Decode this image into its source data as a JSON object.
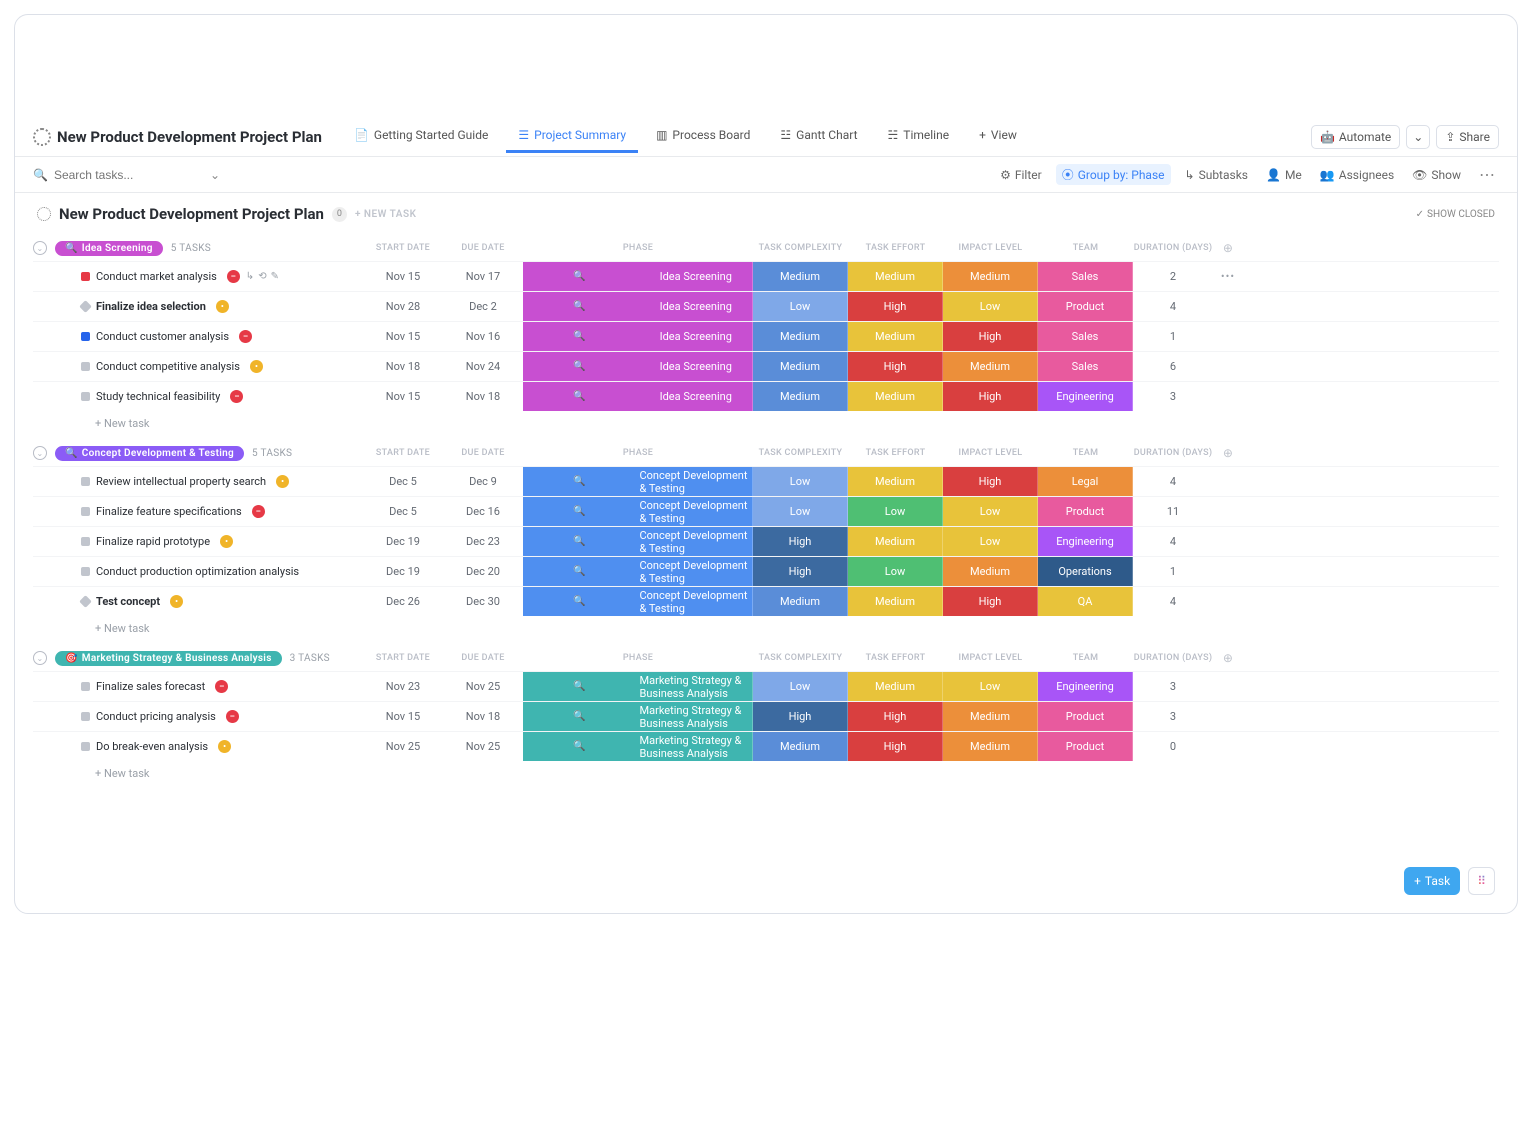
{
  "header": {
    "title": "New Product Development Project Plan",
    "tabs": [
      {
        "label": "Getting Started Guide"
      },
      {
        "label": "Project Summary",
        "active": true
      },
      {
        "label": "Process Board"
      },
      {
        "label": "Gantt Chart"
      },
      {
        "label": "Timeline"
      }
    ],
    "add_view": "View",
    "automate": "Automate",
    "share": "Share"
  },
  "toolbar": {
    "search_placeholder": "Search tasks...",
    "filter": "Filter",
    "group_by": "Group by: Phase",
    "subtasks": "Subtasks",
    "me": "Me",
    "assignees": "Assignees",
    "show": "Show"
  },
  "list": {
    "name": "New Product Development Project Plan",
    "count": "0",
    "new_task": "+ NEW TASK",
    "show_closed": "SHOW CLOSED"
  },
  "columns": [
    "",
    "START DATE",
    "DUE DATE",
    "PHASE",
    "TASK COMPLEXITY",
    "TASK EFFORT",
    "IMPACT LEVEL",
    "TEAM",
    "DURATION (DAYS)",
    ""
  ],
  "groups": [
    {
      "chip": "Idea Screening",
      "chip_color": "c-magenta",
      "chip_icon": "🔍",
      "count": "5 TASKS",
      "tasks": [
        {
          "sq": "sq-red",
          "name": "Conduct market analysis",
          "si": "si-red",
          "hover": true,
          "start": "Nov 15",
          "due": "Nov 17",
          "phase": "Idea Screening",
          "phase_c": "c-magenta",
          "complex": "Medium",
          "complex_c": "c-bluemed",
          "effort": "Medium",
          "effort_c": "c-yellow",
          "impact": "Medium",
          "impact_c": "c-orange",
          "team": "Sales",
          "team_c": "c-pink",
          "dur": "2",
          "more": true
        },
        {
          "sq": "sq-dia",
          "name": "Finalize idea selection",
          "bold": true,
          "si": "si-yellow",
          "start": "Nov 28",
          "due": "Dec 2",
          "phase": "Idea Screening",
          "phase_c": "c-magenta",
          "complex": "Low",
          "complex_c": "c-lightblue",
          "effort": "High",
          "effort_c": "c-red",
          "impact": "Low",
          "impact_c": "c-yellow",
          "team": "Product",
          "team_c": "c-pink",
          "dur": "4"
        },
        {
          "sq": "sq-blue",
          "name": "Conduct customer analysis",
          "si": "si-red",
          "start": "Nov 15",
          "due": "Nov 16",
          "phase": "Idea Screening",
          "phase_c": "c-magenta",
          "complex": "Medium",
          "complex_c": "c-bluemed",
          "effort": "Medium",
          "effort_c": "c-yellow",
          "impact": "High",
          "impact_c": "c-red",
          "team": "Sales",
          "team_c": "c-pink",
          "dur": "1"
        },
        {
          "sq": "sq-gray",
          "name": "Conduct competitive analysis",
          "si": "si-yellow",
          "start": "Nov 18",
          "due": "Nov 24",
          "phase": "Idea Screening",
          "phase_c": "c-magenta",
          "complex": "Medium",
          "complex_c": "c-bluemed",
          "effort": "High",
          "effort_c": "c-red",
          "impact": "Medium",
          "impact_c": "c-orange",
          "team": "Sales",
          "team_c": "c-pink",
          "dur": "6"
        },
        {
          "sq": "sq-gray",
          "name": "Study technical feasibility",
          "si": "si-red",
          "start": "Nov 15",
          "due": "Nov 18",
          "phase": "Idea Screening",
          "phase_c": "c-magenta",
          "complex": "Medium",
          "complex_c": "c-bluemed",
          "effort": "Medium",
          "effort_c": "c-yellow",
          "impact": "High",
          "impact_c": "c-red",
          "team": "Engineering",
          "team_c": "c-violet",
          "dur": "3"
        }
      ],
      "new": "+ New task"
    },
    {
      "chip": "Concept Development & Testing",
      "chip_color": "c-purple",
      "chip_icon": "🔍",
      "count": "5 TASKS",
      "tasks": [
        {
          "sq": "sq-gray",
          "name": "Review intellectual property search",
          "si": "si-yellow",
          "start": "Dec 5",
          "due": "Dec 9",
          "phase": "Concept Development & Testing",
          "phase_c": "c-blue",
          "complex": "Low",
          "complex_c": "c-lightblue",
          "effort": "Medium",
          "effort_c": "c-yellow",
          "impact": "High",
          "impact_c": "c-red",
          "team": "Legal",
          "team_c": "c-orange",
          "dur": "4"
        },
        {
          "sq": "sq-gray",
          "name": "Finalize feature specifications",
          "si": "si-red",
          "start": "Dec 5",
          "due": "Dec 16",
          "phase": "Concept Development & Testing",
          "phase_c": "c-blue",
          "complex": "Low",
          "complex_c": "c-lightblue",
          "effort": "Low",
          "effort_c": "c-green",
          "impact": "Low",
          "impact_c": "c-yellow",
          "team": "Product",
          "team_c": "c-pink",
          "dur": "11"
        },
        {
          "sq": "sq-gray",
          "name": "Finalize rapid prototype",
          "si": "si-yellow",
          "start": "Dec 19",
          "due": "Dec 23",
          "phase": "Concept Development & Testing",
          "phase_c": "c-blue",
          "complex": "High",
          "complex_c": "c-darkblue",
          "effort": "Medium",
          "effort_c": "c-yellow",
          "impact": "Low",
          "impact_c": "c-yellow",
          "team": "Engineering",
          "team_c": "c-violet",
          "dur": "4"
        },
        {
          "sq": "sq-gray",
          "name": "Conduct production optimization analysis",
          "start": "Dec 19",
          "due": "Dec 20",
          "phase": "Concept Development & Testing",
          "phase_c": "c-blue",
          "complex": "High",
          "complex_c": "c-darkblue",
          "effort": "Low",
          "effort_c": "c-green",
          "impact": "Medium",
          "impact_c": "c-orange",
          "team": "Operations",
          "team_c": "c-navy",
          "dur": "1"
        },
        {
          "sq": "sq-dia",
          "name": "Test concept",
          "bold": true,
          "si": "si-yellow",
          "start": "Dec 26",
          "due": "Dec 30",
          "phase": "Concept Development & Testing",
          "phase_c": "c-blue",
          "complex": "Medium",
          "complex_c": "c-bluemed",
          "effort": "Medium",
          "effort_c": "c-yellow",
          "impact": "High",
          "impact_c": "c-red",
          "team": "QA",
          "team_c": "c-yellow",
          "dur": "4"
        }
      ],
      "new": "+ New task"
    },
    {
      "chip": "Marketing Strategy & Business Analysis",
      "chip_color": "c-teal",
      "chip_icon": "🎯",
      "count": "3 TASKS",
      "tasks": [
        {
          "sq": "sq-gray",
          "name": "Finalize sales forecast",
          "si": "si-red",
          "start": "Nov 23",
          "due": "Nov 25",
          "phase": "Marketing Strategy & Business Analysis",
          "phase_c": "c-teal",
          "complex": "Low",
          "complex_c": "c-lightblue",
          "effort": "Medium",
          "effort_c": "c-yellow",
          "impact": "Low",
          "impact_c": "c-yellow",
          "team": "Engineering",
          "team_c": "c-violet",
          "dur": "3"
        },
        {
          "sq": "sq-gray",
          "name": "Conduct pricing analysis",
          "si": "si-red",
          "start": "Nov 15",
          "due": "Nov 18",
          "phase": "Marketing Strategy & Business Analysis",
          "phase_c": "c-teal",
          "complex": "High",
          "complex_c": "c-darkblue",
          "effort": "High",
          "effort_c": "c-red",
          "impact": "Medium",
          "impact_c": "c-orange",
          "team": "Product",
          "team_c": "c-pink",
          "dur": "3"
        },
        {
          "sq": "sq-gray",
          "name": "Do break-even analysis",
          "si": "si-yellow",
          "start": "Nov 25",
          "due": "Nov 25",
          "phase": "Marketing Strategy & Business Analysis",
          "phase_c": "c-teal",
          "complex": "Medium",
          "complex_c": "c-bluemed",
          "effort": "High",
          "effort_c": "c-red",
          "impact": "Medium",
          "impact_c": "c-orange",
          "team": "Product",
          "team_c": "c-pink",
          "dur": "0"
        }
      ],
      "new": "+ New task"
    }
  ],
  "fab": {
    "task": "Task"
  }
}
